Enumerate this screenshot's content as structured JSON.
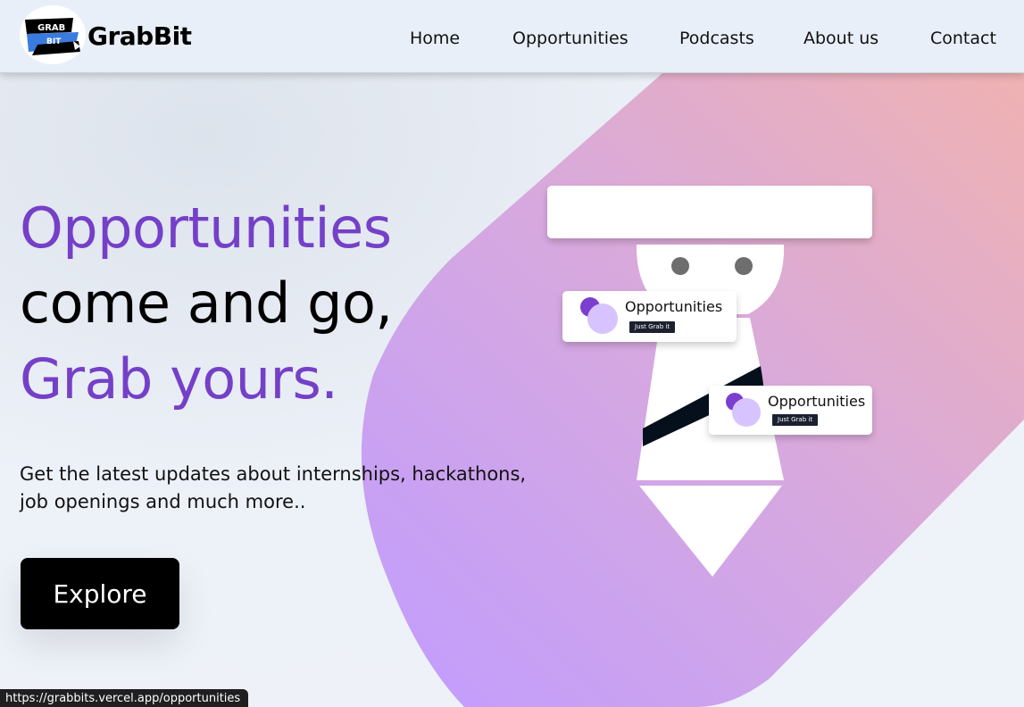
{
  "app": {
    "brand": "GrabBit",
    "logo_top": "GRAB",
    "logo_bottom": "BIT"
  },
  "nav": {
    "items": [
      {
        "label": "Home"
      },
      {
        "label": "Opportunities"
      },
      {
        "label": "Podcasts"
      },
      {
        "label": "About us"
      },
      {
        "label": "Contact"
      }
    ]
  },
  "hero": {
    "line1": "Opportunities",
    "line2": "come and go,",
    "line3": "Grab yours.",
    "subcopy": "Get the latest updates about internships, hackathons, job openings and much more..",
    "cta_label": "Explore"
  },
  "illustration": {
    "card1_title": "Opportunities",
    "card1_button": "Just Grab it",
    "card2_title": "Opportunities",
    "card2_button": "Just Grab it"
  },
  "status_bar": {
    "url": "https://grabbits.vercel.app/opportunities"
  },
  "colors": {
    "accent_purple": "#7540c8",
    "nav_bg": "#e9eff8",
    "band_start": "#c29bff",
    "band_end": "#ecb4b6",
    "button_bg": "#000000"
  },
  "icons": {
    "logo": "grabbit-logo-icon",
    "cursor": "cursor-icon"
  }
}
